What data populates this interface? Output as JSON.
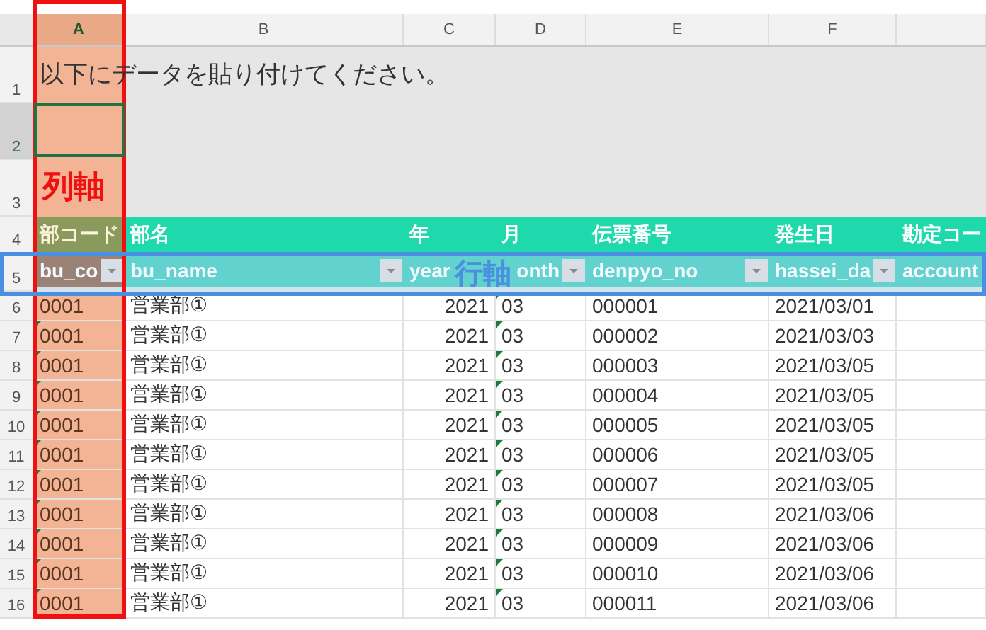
{
  "column_headers": [
    {
      "label": "A",
      "selected": true
    },
    {
      "label": "B",
      "selected": false
    },
    {
      "label": "C",
      "selected": false
    },
    {
      "label": "D",
      "selected": false
    },
    {
      "label": "E",
      "selected": false
    },
    {
      "label": "F",
      "selected": false
    }
  ],
  "top_rows": [
    {
      "number": "1",
      "text": "以下にデータを貼り付けてください。",
      "selected": false
    },
    {
      "number": "2",
      "selected": true
    },
    {
      "number": "3",
      "selected": false
    }
  ],
  "header_row": {
    "number": "4",
    "cells": [
      "部コード",
      "部名",
      "年",
      "月",
      "伝票番号",
      "発生日",
      "勘定コー"
    ]
  },
  "field_row": {
    "number": "5",
    "cells": [
      {
        "text": "bu_co",
        "filter": true
      },
      {
        "text": "bu_name",
        "filter": true
      },
      {
        "text": "year",
        "filter": false
      },
      {
        "text": "onth",
        "filter": true
      },
      {
        "text": "denpyo_no",
        "filter": true
      },
      {
        "text": "hassei_da",
        "filter": true
      },
      {
        "text": "account",
        "filter": false
      }
    ]
  },
  "rows": [
    {
      "number": "6",
      "code": "0001",
      "name": "営業部①",
      "year": "2021",
      "month": "03",
      "denpyo": "000001",
      "date": "2021/03/01"
    },
    {
      "number": "7",
      "code": "0001",
      "name": "営業部①",
      "year": "2021",
      "month": "03",
      "denpyo": "000002",
      "date": "2021/03/03"
    },
    {
      "number": "8",
      "code": "0001",
      "name": "営業部①",
      "year": "2021",
      "month": "03",
      "denpyo": "000003",
      "date": "2021/03/05"
    },
    {
      "number": "9",
      "code": "0001",
      "name": "営業部①",
      "year": "2021",
      "month": "03",
      "denpyo": "000004",
      "date": "2021/03/05"
    },
    {
      "number": "10",
      "code": "0001",
      "name": "営業部①",
      "year": "2021",
      "month": "03",
      "denpyo": "000005",
      "date": "2021/03/05"
    },
    {
      "number": "11",
      "code": "0001",
      "name": "営業部①",
      "year": "2021",
      "month": "03",
      "denpyo": "000006",
      "date": "2021/03/05"
    },
    {
      "number": "12",
      "code": "0001",
      "name": "営業部①",
      "year": "2021",
      "month": "03",
      "denpyo": "000007",
      "date": "2021/03/05"
    },
    {
      "number": "13",
      "code": "0001",
      "name": "営業部①",
      "year": "2021",
      "month": "03",
      "denpyo": "000008",
      "date": "2021/03/06"
    },
    {
      "number": "14",
      "code": "0001",
      "name": "営業部①",
      "year": "2021",
      "month": "03",
      "denpyo": "000009",
      "date": "2021/03/06"
    },
    {
      "number": "15",
      "code": "0001",
      "name": "営業部①",
      "year": "2021",
      "month": "03",
      "denpyo": "000010",
      "date": "2021/03/06"
    },
    {
      "number": "16",
      "code": "0001",
      "name": "営業部①",
      "year": "2021",
      "month": "03",
      "denpyo": "000011",
      "date": "2021/03/06"
    }
  ],
  "annotations": [
    {
      "kind": "column",
      "label": "列軸"
    },
    {
      "kind": "row",
      "label": "行軸"
    }
  ]
}
